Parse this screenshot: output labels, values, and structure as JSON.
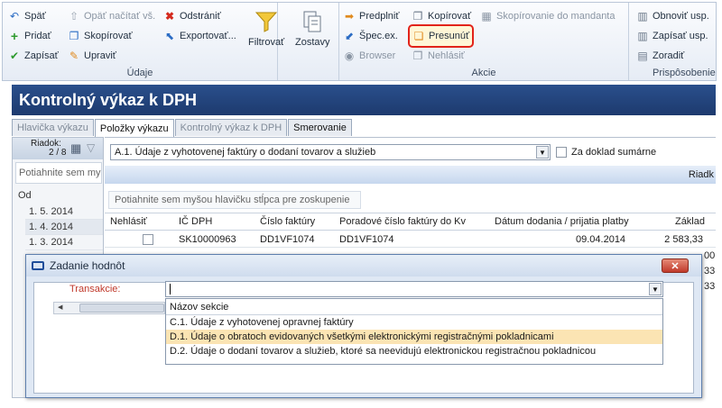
{
  "ribbon": {
    "udaje": {
      "label": "Údaje",
      "spat": "Späť",
      "pridat": "Pridať",
      "zapisat": "Zapísať",
      "opat_nacitat": "Opäť načítať vš.",
      "skopirovat": "Skopírovať",
      "upravit": "Upraviť",
      "odstranit": "Odstrániť",
      "exportovat": "Exportovať...",
      "filtrovat": "Filtrovať",
      "zostavy": "Zostavy"
    },
    "akcie": {
      "label": "Akcie",
      "predplnit": "Predplniť",
      "spec_ex": "Špec.ex.",
      "browser": "Browser",
      "kopirovat": "Kopírovať",
      "presunut": "Presunúť",
      "nehlasit": "Nehlásiť",
      "skopirovanie": "Skopírovanie do mandanta"
    },
    "prisposobenie": {
      "label": "Prispôsobenie",
      "obnovit": "Obnoviť usp.",
      "zapisat": "Zapísať usp.",
      "zoradit": "Zoradiť"
    }
  },
  "window_title": "Kontrolný výkaz k DPH",
  "tabs": [
    "Hlavička výkazu",
    "Položky výkazu",
    "Kontrolný výkaz k DPH",
    "Smerovanie"
  ],
  "left_panel": {
    "riadok_label": "Riadok:",
    "riadok_value": "2 / 8",
    "drag_hint": "Potiahnite sem myšou hlavičku stĺpca pre zoskupenie",
    "od_label": "Od",
    "dates": [
      "1. 5. 2014",
      "1. 4. 2014",
      "1. 3. 2014"
    ]
  },
  "main": {
    "section_combo": "A.1. Údaje z vyhotovenej faktúry o dodaní tovarov a služieb",
    "za_doklad_label": "Za doklad sumárne",
    "band_label": "Riadk",
    "group_hint": "Potiahnite sem myšou hlavičku stĺpca pre zoskupenie",
    "columns": [
      "Nehlásiť",
      "IČ DPH",
      "Číslo faktúry",
      "Poradové číslo faktúry do Kv",
      "Dátum dodania / prijatia platby",
      "Základ"
    ],
    "row": {
      "ic_dph": "SK10000963",
      "cislo_faktury": "DD1VF1074",
      "poradove": "DD1VF1074",
      "datum": "09.04.2014",
      "zaklad": "2 583,33"
    },
    "side_values": [
      "00",
      "33",
      "33"
    ]
  },
  "dialog": {
    "title": "Zadanie hodnôt",
    "close_label": "✕",
    "transakcie_label": "Transakcie:",
    "dropdown_header": "Názov sekcie",
    "options": [
      "C.1. Údaje z vyhotovenej opravnej faktúry",
      "D.1. Údaje o obratoch evidovaných všetkými elektronickými registračnými pokladnicami",
      "D.2. Údaje o dodaní tovarov a služieb, ktoré sa neevidujú elektronickou registračnou pokladnicou"
    ]
  },
  "colors": {
    "title_bar": "#1d3a6e",
    "highlight_outline": "#e2231a",
    "selected_option": "#fbe4b3",
    "required_label": "#c0392b"
  }
}
